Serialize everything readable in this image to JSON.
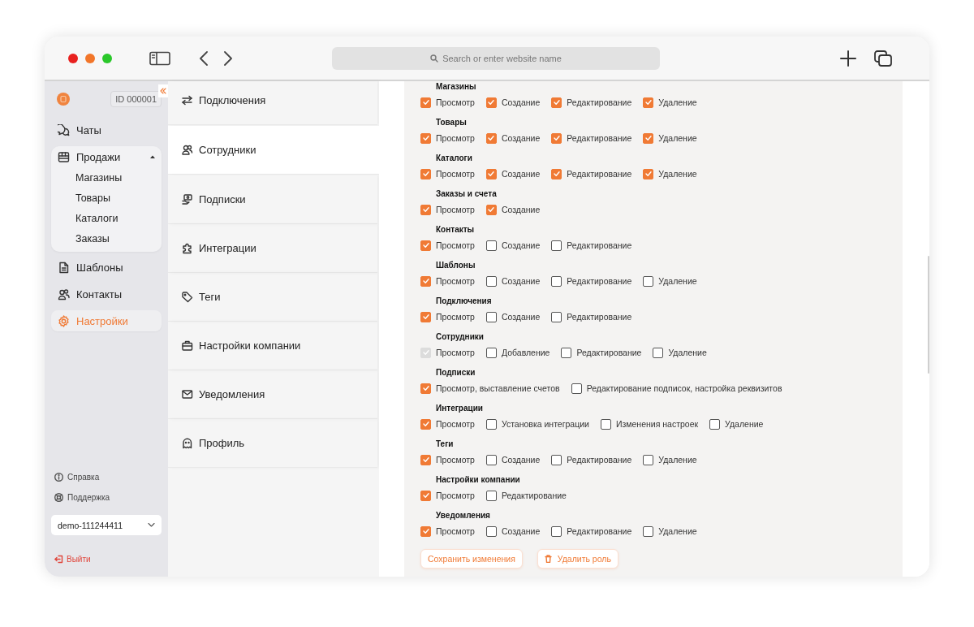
{
  "browser": {
    "address_placeholder": "Search or enter website name"
  },
  "sidebar": {
    "account_id": "ID 000001",
    "nav": [
      {
        "label": "Чаты",
        "selected": false
      },
      {
        "label": "Продажи",
        "selected": false,
        "expanded": true,
        "children": [
          {
            "label": "Магазины",
            "selected": false
          },
          {
            "label": "Товары",
            "selected": false
          },
          {
            "label": "Каталоги",
            "selected": false
          },
          {
            "label": "Заказы",
            "selected": false
          }
        ]
      },
      {
        "label": "Шаблоны",
        "selected": false
      },
      {
        "label": "Контакты",
        "selected": false
      },
      {
        "label": "Настройки",
        "selected": true
      }
    ],
    "footer_links": [
      "Справка",
      "Поддержка"
    ],
    "workspace_select": "demo-111244411",
    "logout": "Выйти"
  },
  "settings_menu": [
    {
      "label": "Подключения",
      "selected": false
    },
    {
      "label": "Сотрудники",
      "selected": true
    },
    {
      "label": "Подписки",
      "selected": false
    },
    {
      "label": "Интеграции",
      "selected": false
    },
    {
      "label": "Теги",
      "selected": false
    },
    {
      "label": "Настройки компании",
      "selected": false
    },
    {
      "label": "Уведомления",
      "selected": false
    },
    {
      "label": "Профиль",
      "selected": false
    }
  ],
  "permissions": [
    {
      "title": "Магазины",
      "perms": [
        {
          "label": "Просмотр",
          "checked": true,
          "disabled": false
        },
        {
          "label": "Создание",
          "checked": true,
          "disabled": false
        },
        {
          "label": "Редактирование",
          "checked": true,
          "disabled": false
        },
        {
          "label": "Удаление",
          "checked": true,
          "disabled": false
        }
      ]
    },
    {
      "title": "Товары",
      "perms": [
        {
          "label": "Просмотр",
          "checked": true,
          "disabled": false
        },
        {
          "label": "Создание",
          "checked": true,
          "disabled": false
        },
        {
          "label": "Редактирование",
          "checked": true,
          "disabled": false
        },
        {
          "label": "Удаление",
          "checked": true,
          "disabled": false
        }
      ]
    },
    {
      "title": "Каталоги",
      "perms": [
        {
          "label": "Просмотр",
          "checked": true,
          "disabled": false
        },
        {
          "label": "Создание",
          "checked": true,
          "disabled": false
        },
        {
          "label": "Редактирование",
          "checked": true,
          "disabled": false
        },
        {
          "label": "Удаление",
          "checked": true,
          "disabled": false
        }
      ]
    },
    {
      "title": "Заказы и счета",
      "perms": [
        {
          "label": "Просмотр",
          "checked": true,
          "disabled": false
        },
        {
          "label": "Создание",
          "checked": true,
          "disabled": false
        }
      ]
    },
    {
      "title": "Контакты",
      "perms": [
        {
          "label": "Просмотр",
          "checked": true,
          "disabled": false
        },
        {
          "label": "Создание",
          "checked": false,
          "disabled": false
        },
        {
          "label": "Редактирование",
          "checked": false,
          "disabled": false
        }
      ]
    },
    {
      "title": "Шаблоны",
      "perms": [
        {
          "label": "Просмотр",
          "checked": true,
          "disabled": false
        },
        {
          "label": "Создание",
          "checked": false,
          "disabled": false
        },
        {
          "label": "Редактирование",
          "checked": false,
          "disabled": false
        },
        {
          "label": "Удаление",
          "checked": false,
          "disabled": false
        }
      ]
    },
    {
      "title": "Подключения",
      "perms": [
        {
          "label": "Просмотр",
          "checked": true,
          "disabled": false
        },
        {
          "label": "Создание",
          "checked": false,
          "disabled": false
        },
        {
          "label": "Редактирование",
          "checked": false,
          "disabled": false
        }
      ]
    },
    {
      "title": "Сотрудники",
      "perms": [
        {
          "label": "Просмотр",
          "checked": true,
          "disabled": true
        },
        {
          "label": "Добавление",
          "checked": false,
          "disabled": false
        },
        {
          "label": "Редактирование",
          "checked": false,
          "disabled": false
        },
        {
          "label": "Удаление",
          "checked": false,
          "disabled": false
        }
      ]
    },
    {
      "title": "Подписки",
      "perms": [
        {
          "label": "Просмотр, выставление счетов",
          "checked": true,
          "disabled": false
        },
        {
          "label": "Редактирование подписок, настройка реквизитов",
          "checked": false,
          "disabled": false
        }
      ]
    },
    {
      "title": "Интеграции",
      "perms": [
        {
          "label": "Просмотр",
          "checked": true,
          "disabled": false
        },
        {
          "label": "Установка интеграции",
          "checked": false,
          "disabled": false
        },
        {
          "label": "Изменения настроек",
          "checked": false,
          "disabled": false
        },
        {
          "label": "Удаление",
          "checked": false,
          "disabled": false
        }
      ]
    },
    {
      "title": "Теги",
      "perms": [
        {
          "label": "Просмотр",
          "checked": true,
          "disabled": false
        },
        {
          "label": "Создание",
          "checked": false,
          "disabled": false
        },
        {
          "label": "Редактирование",
          "checked": false,
          "disabled": false
        },
        {
          "label": "Удаление",
          "checked": false,
          "disabled": false
        }
      ]
    },
    {
      "title": "Настройки компании",
      "perms": [
        {
          "label": "Просмотр",
          "checked": true,
          "disabled": false
        },
        {
          "label": "Редактирование",
          "checked": false,
          "disabled": false
        }
      ]
    },
    {
      "title": "Уведомления",
      "perms": [
        {
          "label": "Просмотр",
          "checked": true,
          "disabled": false
        },
        {
          "label": "Создание",
          "checked": false,
          "disabled": false
        },
        {
          "label": "Редактирование",
          "checked": false,
          "disabled": false
        },
        {
          "label": "Удаление",
          "checked": false,
          "disabled": false
        }
      ]
    }
  ],
  "actions": {
    "save": "Сохранить изменения",
    "delete": "Удалить роль"
  }
}
